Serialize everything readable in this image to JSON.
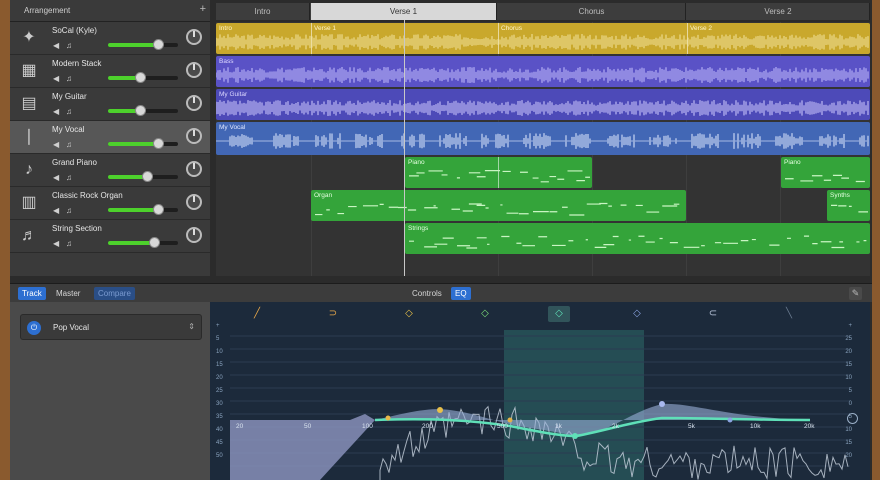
{
  "arrangement": {
    "title": "Arrangement",
    "add_label": "+",
    "sections": [
      {
        "label": "Intro",
        "active": false
      },
      {
        "label": "Verse 1",
        "active": true
      },
      {
        "label": "Chorus",
        "active": false
      },
      {
        "label": "Verse 2",
        "active": false
      }
    ]
  },
  "tracks": [
    {
      "name": "SoCal (Kyle)",
      "icon": "drummer-icon",
      "glyph": "✦",
      "volume": 0.72,
      "selected": false
    },
    {
      "name": "Modern Stack",
      "icon": "amp-icon",
      "glyph": "▦",
      "volume": 0.45,
      "selected": false
    },
    {
      "name": "My Guitar",
      "icon": "guitar-amp-icon",
      "glyph": "▤",
      "volume": 0.45,
      "selected": false
    },
    {
      "name": "My Vocal",
      "icon": "microphone-icon",
      "glyph": "❘",
      "volume": 0.72,
      "selected": true
    },
    {
      "name": "Grand Piano",
      "icon": "piano-icon",
      "glyph": "♪",
      "volume": 0.55,
      "selected": false
    },
    {
      "name": "Classic Rock Organ",
      "icon": "organ-icon",
      "glyph": "▥",
      "volume": 0.72,
      "selected": false
    },
    {
      "name": "String Section",
      "icon": "strings-icon",
      "glyph": "♬",
      "volume": 0.65,
      "selected": false
    }
  ],
  "regions": {
    "drummer": [
      "Intro",
      "Verse 1",
      "Chorus",
      "Verse 2"
    ],
    "bass": "Bass",
    "guitar": "My Guitar",
    "vocal": "My Vocal",
    "piano": [
      "Piano",
      "Piano"
    ],
    "organ": [
      "Organ",
      "Synths"
    ],
    "strings": "Strings"
  },
  "editor": {
    "tabs": [
      "Track",
      "Master",
      "Compare"
    ],
    "center_tabs": [
      "Controls",
      "EQ"
    ],
    "preset": "Pop Vocal"
  },
  "eq": {
    "db_left": [
      "+",
      "5",
      "10",
      "15",
      "20",
      "25",
      "30",
      "35",
      "40",
      "45",
      "50"
    ],
    "db_right": [
      "+",
      "25",
      "20",
      "15",
      "10",
      "5",
      "0",
      "5",
      "10",
      "15",
      "20"
    ],
    "freqs": [
      "20",
      "50",
      "100",
      "200",
      "500",
      "1k",
      "2k",
      "5k",
      "10k",
      "20k"
    ]
  },
  "colors": {
    "drummer": "#c9a82c",
    "bass": "#5a52c6",
    "vocal": "#4267b5",
    "midi": "#34a43a",
    "accent": "#2d6fd1"
  }
}
